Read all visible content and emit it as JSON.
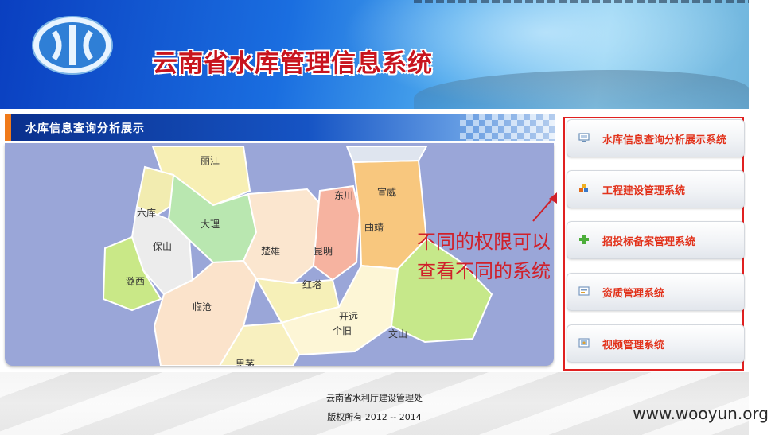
{
  "header": {
    "title": "云南省水库管理信息系统",
    "logo_icon": "water-logo-icon"
  },
  "panel": {
    "title": "水库信息查询分析展示"
  },
  "map": {
    "labels": [
      "丽江",
      "大理",
      "东川",
      "宣威",
      "保山",
      "曲靖",
      "楚雄",
      "昆明",
      "潞西",
      "临沧",
      "红塔",
      "开远",
      "个旧",
      "文山",
      "思茅",
      "六库"
    ]
  },
  "annotation": {
    "line1": "不同的权限可以",
    "line2": "查看不同的系统"
  },
  "menu": [
    {
      "label": "水库信息查询分析展示系统",
      "icon": "monitor-icon"
    },
    {
      "label": "工程建设管理系统",
      "icon": "blocks-icon"
    },
    {
      "label": "招投标备案管理系统",
      "icon": "plus-icon"
    },
    {
      "label": "资质管理系统",
      "icon": "certificate-icon"
    },
    {
      "label": "视频管理系统",
      "icon": "video-icon"
    }
  ],
  "footer": {
    "org": "云南省水利厅建设管理处",
    "copyright": "版权所有 2012 -- 2014"
  },
  "watermark": "www.wooyun.org",
  "colors": {
    "title_red": "#c8141e",
    "menu_text": "#e2321b",
    "annotation_red": "#d0202a",
    "bar_blue": "#1654c4"
  }
}
